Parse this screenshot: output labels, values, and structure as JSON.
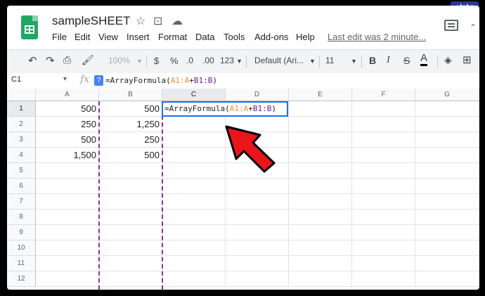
{
  "watermark": "alphr",
  "doc": {
    "title": "sampleSHEET"
  },
  "menu": [
    "File",
    "Edit",
    "View",
    "Insert",
    "Format",
    "Data",
    "Tools",
    "Add-ons",
    "Help"
  ],
  "last_edit": "Last edit was 2 minute...",
  "toolbar": {
    "zoom": "100%",
    "currency": "$",
    "percent": "%",
    "dec_less": ".0",
    "dec_more": ".00",
    "format123": "123",
    "font": "Default (Ari...",
    "size": "11",
    "bold": "B",
    "italic": "I",
    "strike": "S",
    "textcolor": "A"
  },
  "formula_bar": {
    "cell_ref": "C1",
    "fx": "fx",
    "help": "?",
    "formula_pre": "=ArrayFormula(",
    "formula_r1": "A1:A",
    "formula_plus": "+",
    "formula_r2": "B1:B",
    "formula_post": ")"
  },
  "columns": [
    "A",
    "B",
    "C",
    "D",
    "E",
    "F",
    "G"
  ],
  "rows": [
    "1",
    "2",
    "3",
    "4",
    "5",
    "6",
    "7",
    "8",
    "9",
    "10",
    "11",
    "12"
  ],
  "cells": {
    "A": [
      "500",
      "250",
      "500",
      "1,500"
    ],
    "B": [
      "500",
      "1,250",
      "250",
      "500"
    ]
  },
  "colors": {
    "arrow": "#e8151b",
    "selection": "#1a73e8",
    "dashed_border": "#8a2f9c",
    "logo": "#23a566"
  },
  "icons": [
    "undo-icon",
    "redo-icon",
    "print-icon",
    "paint-format-icon",
    "star-icon",
    "move-to-folder-icon",
    "cloud-status-icon",
    "comment-icon",
    "fill-color-icon",
    "borders-icon",
    "red-arrow-icon"
  ]
}
